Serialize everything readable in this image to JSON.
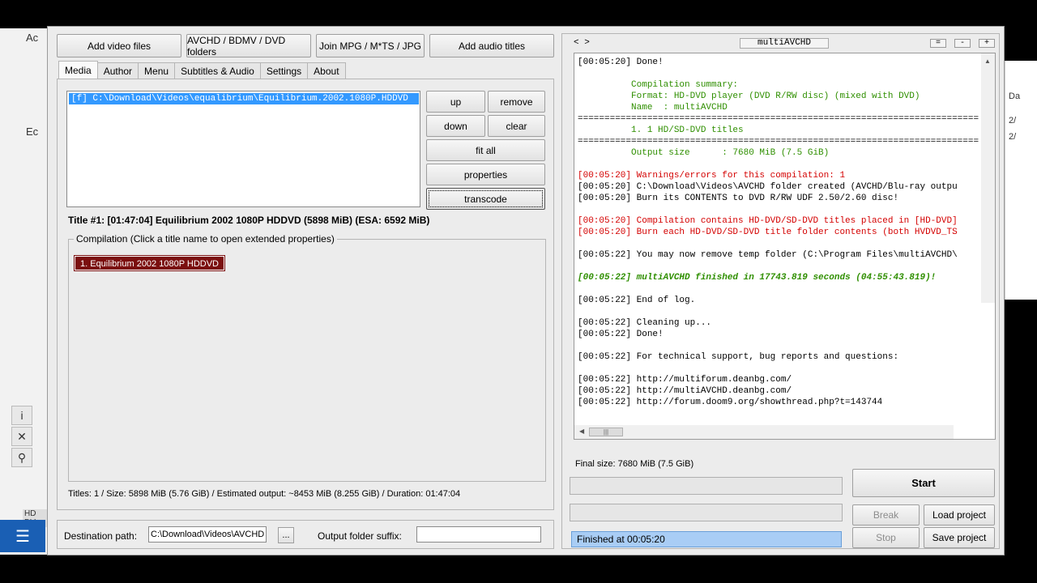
{
  "background": {
    "left_fragments": [
      "Ac",
      "Ec"
    ],
    "right_fragments": [
      "Da",
      "2/",
      "2/"
    ],
    "taskbar_label": "HD DV"
  },
  "toolbar": {
    "add_video": "Add video files",
    "avchd_folders": "AVCHD / BDMV / DVD folders",
    "join": "Join MPG / M*TS / JPG",
    "add_audio": "Add audio titles"
  },
  "tabs": [
    "Media",
    "Author",
    "Menu",
    "Subtitles & Audio",
    "Settings",
    "About"
  ],
  "media": {
    "file_entry": "[f] C:\\Download\\Videos\\equalibrium\\Equilibrium.2002.1080P.HDDVD",
    "buttons": {
      "up": "up",
      "remove": "remove",
      "down": "down",
      "clear": "clear",
      "fit_all": "fit all",
      "properties": "properties",
      "transcode": "transcode"
    },
    "title_info": "Title #1: [01:47:04] Equilibrium 2002 1080P HDDVD (5898 MiB) (ESA: 6592 MiB)",
    "compilation_legend": "Compilation (Click a title name to open extended properties)",
    "compilation_item": "1. Equilibrium 2002 1080P HDDVD",
    "summary": "Titles: 1 / Size: 5898 MiB (5.76 GiB) / Estimated output: ~8453 MiB (8.255 GiB) / Duration: 01:47:04"
  },
  "destination": {
    "label": "Destination path:",
    "value": "C:\\Download\\Videos\\AVCHD\\",
    "browse": "...",
    "suffix_label": "Output folder suffix:",
    "suffix_value": ""
  },
  "log_panel": {
    "toggle": "< >",
    "title": "multiAVCHD",
    "controls": [
      "=",
      "-",
      "+"
    ],
    "lines": [
      {
        "t": "[00:05:20] Done!",
        "c": ""
      },
      {
        "t": "",
        "c": ""
      },
      {
        "t": "          Compilation summary:",
        "c": "lg"
      },
      {
        "t": "          Format: HD-DVD player (DVD R/RW disc) (mixed with DVD)",
        "c": "lg"
      },
      {
        "t": "          Name  : multiAVCHD",
        "c": "lg"
      },
      {
        "t": "==============================================================================",
        "c": "lsep"
      },
      {
        "t": "          1. 1 HD/SD-DVD titles",
        "c": "lg"
      },
      {
        "t": "==============================================================================",
        "c": "lsep"
      },
      {
        "t": "          Output size      : 7680 MiB (7.5 GiB)",
        "c": "lg"
      },
      {
        "t": "",
        "c": ""
      },
      {
        "t": "[00:05:20] Warnings/errors for this compilation: 1",
        "c": "lr"
      },
      {
        "t": "[00:05:20] C:\\Download\\Videos\\AVCHD folder created (AVCHD/Blu-ray outpu",
        "c": ""
      },
      {
        "t": "[00:05:20] Burn its CONTENTS to DVD R/RW UDF 2.50/2.60 disc!",
        "c": ""
      },
      {
        "t": "",
        "c": ""
      },
      {
        "t": "[00:05:20] Compilation contains HD-DVD/SD-DVD titles placed in [HD-DVD]",
        "c": "lr"
      },
      {
        "t": "[00:05:20] Burn each HD-DVD/SD-DVD title folder contents (both HVDVD_TS",
        "c": "lr"
      },
      {
        "t": "",
        "c": ""
      },
      {
        "t": "[00:05:22] You may now remove temp folder (C:\\Program Files\\multiAVCHD\\",
        "c": ""
      },
      {
        "t": "",
        "c": ""
      },
      {
        "t": "[00:05:22] multiAVCHD finished in 17743.819 seconds (04:55:43.819)!",
        "c": "lgi"
      },
      {
        "t": "",
        "c": ""
      },
      {
        "t": "[00:05:22] End of log.",
        "c": ""
      },
      {
        "t": "",
        "c": ""
      },
      {
        "t": "[00:05:22] Cleaning up...",
        "c": ""
      },
      {
        "t": "[00:05:22] Done!",
        "c": ""
      },
      {
        "t": "",
        "c": ""
      },
      {
        "t": "[00:05:22] For technical support, bug reports and questions:",
        "c": ""
      },
      {
        "t": "",
        "c": ""
      },
      {
        "t": "[00:05:22] http://multiforum.deanbg.com/",
        "c": ""
      },
      {
        "t": "[00:05:22] http://multiAVCHD.deanbg.com/",
        "c": ""
      },
      {
        "t": "[00:05:22] http://forum.doom9.org/showthread.php?t=143744",
        "c": ""
      }
    ],
    "final_size": "Final size: 7680 MiB (7.5 GiB)",
    "status": "Finished at 00:05:20",
    "buttons": {
      "start": "Start",
      "break": "Break",
      "load_project": "Load project",
      "stop": "Stop",
      "save_project": "Save project"
    }
  },
  "colors": {
    "selection": "#3399ff",
    "compilation_item": "#7b0f0f",
    "log_green": "#2f8f00",
    "log_red": "#d40000",
    "status_bar": "#a9cdf5"
  }
}
